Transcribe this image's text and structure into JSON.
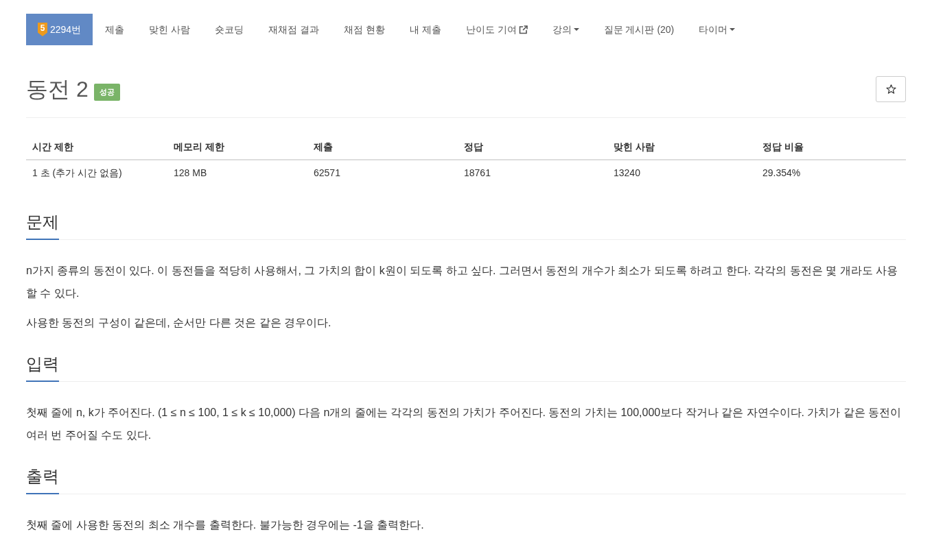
{
  "nav": {
    "tabs": [
      {
        "kind": "problem",
        "tier": "5",
        "label": "2294번",
        "selected": true
      },
      {
        "kind": "link",
        "label": "제출",
        "selected": false
      },
      {
        "kind": "link",
        "label": "맞힌 사람",
        "selected": false
      },
      {
        "kind": "link",
        "label": "숏코딩",
        "selected": false
      },
      {
        "kind": "link",
        "label": "재채점 결과",
        "selected": false
      },
      {
        "kind": "link",
        "label": "채점 현황",
        "selected": false
      },
      {
        "kind": "link",
        "label": "내 제출",
        "selected": false
      },
      {
        "kind": "external",
        "label": "난이도 기여",
        "selected": false
      },
      {
        "kind": "dropdown",
        "label": "강의",
        "selected": false
      },
      {
        "kind": "link",
        "label": "질문 게시판 (20)",
        "selected": false
      },
      {
        "kind": "dropdown",
        "label": "타이머",
        "selected": false
      }
    ]
  },
  "problem": {
    "title": "동전 2",
    "status": "성공",
    "starred": false
  },
  "info_table": {
    "columns": [
      "시간 제한",
      "메모리 제한",
      "제출",
      "정답",
      "맞힌 사람",
      "정답 비율"
    ],
    "rows": [
      [
        "1 초 (추가 시간 없음)",
        "128 MB",
        "62571",
        "18761",
        "13240",
        "29.354%"
      ]
    ]
  },
  "sections": [
    {
      "heading": "문제",
      "paragraphs": [
        "n가지 종류의 동전이 있다. 이 동전들을 적당히 사용해서, 그 가치의 합이 k원이 되도록 하고 싶다. 그러면서 동전의 개수가 최소가 되도록 하려고 한다. 각각의 동전은 몇 개라도 사용할 수 있다.",
        "사용한 동전의 구성이 같은데, 순서만 다른 것은 같은 경우이다."
      ]
    },
    {
      "heading": "입력",
      "paragraphs": [
        "첫째 줄에 n, k가 주어진다. (1 ≤ n ≤ 100, 1 ≤ k ≤ 10,000) 다음 n개의 줄에는 각각의 동전의 가치가 주어진다. 동전의 가치는 100,000보다 작거나 같은 자연수이다. 가치가 같은 동전이 여러 번 주어질 수도 있다."
      ]
    },
    {
      "heading": "출력",
      "paragraphs": [
        "첫째 줄에 사용한 동전의 최소 개수를 출력한다. 불가능한 경우에는 -1을 출력한다."
      ]
    }
  ]
}
